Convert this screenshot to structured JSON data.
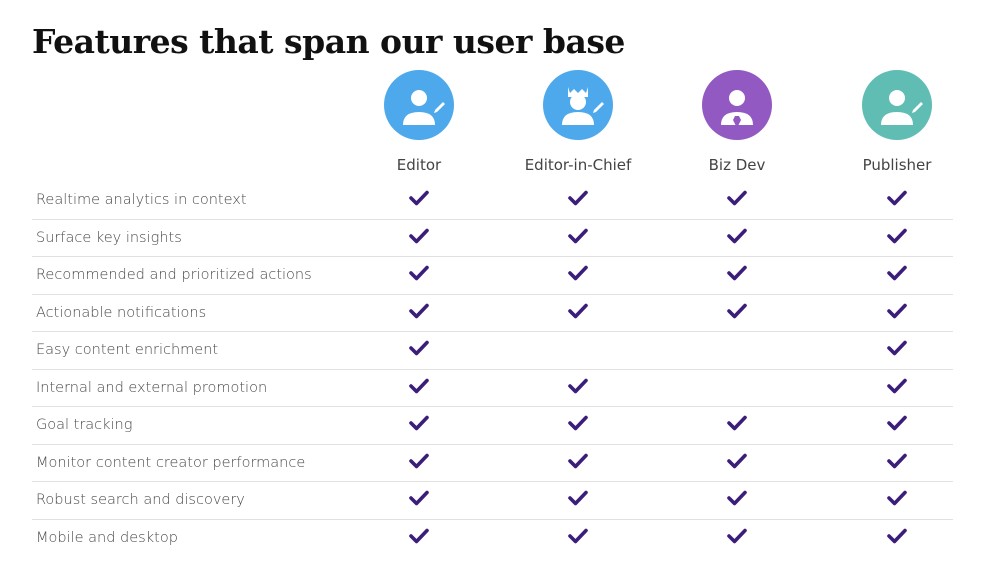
{
  "title": "Features that span our user base",
  "roles": [
    {
      "label": "Editor",
      "color": "#4da8ec",
      "icon": "user-edit-icon"
    },
    {
      "label": "Editor-in-Chief",
      "color": "#4da8ec",
      "icon": "user-crown-edit-icon"
    },
    {
      "label": "Biz Dev",
      "color": "#9159c1",
      "icon": "user-tie-icon"
    },
    {
      "label": "Publisher",
      "color": "#5fbdb4",
      "icon": "user-edit-icon"
    }
  ],
  "check_color": "#3b1e7a",
  "features": [
    {
      "label": "Realtime analytics in context",
      "checks": [
        true,
        true,
        true,
        true
      ]
    },
    {
      "label": "Surface key insights",
      "checks": [
        true,
        true,
        true,
        true
      ]
    },
    {
      "label": "Recommended and prioritized actions",
      "checks": [
        true,
        true,
        true,
        true
      ]
    },
    {
      "label": "Actionable notifications",
      "checks": [
        true,
        true,
        true,
        true
      ]
    },
    {
      "label": "Easy content enrichment",
      "checks": [
        true,
        false,
        false,
        true
      ]
    },
    {
      "label": "Internal and external promotion",
      "checks": [
        true,
        true,
        false,
        true
      ]
    },
    {
      "label": "Goal tracking",
      "checks": [
        true,
        true,
        true,
        true
      ]
    },
    {
      "label": "Monitor content creator performance",
      "checks": [
        true,
        true,
        true,
        true
      ]
    },
    {
      "label": "Robust search and discovery",
      "checks": [
        true,
        true,
        true,
        true
      ]
    },
    {
      "label": "Mobile and desktop",
      "checks": [
        true,
        true,
        true,
        true
      ]
    }
  ]
}
